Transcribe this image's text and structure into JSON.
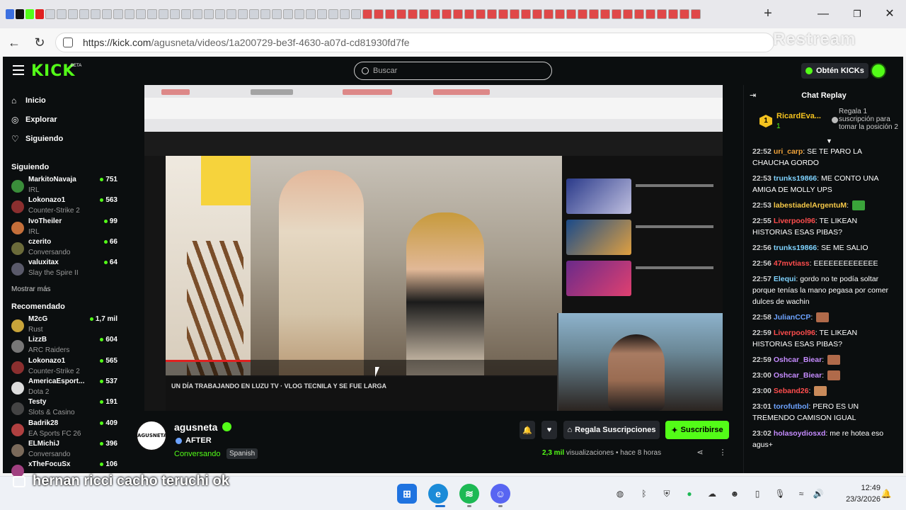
{
  "browser": {
    "url_host": "https://kick.com",
    "url_path": "/agusneta/videos/1a200729-be3f-4630-a07d-cd81930fd7fe",
    "watermark": "Restream"
  },
  "header": {
    "logo": "KICK",
    "logo_badge": "BETA",
    "search_placeholder": "Buscar",
    "kicks_button": "Obtén KICKs"
  },
  "sidebar": {
    "nav": [
      {
        "label": "Inicio",
        "icon": "home-icon"
      },
      {
        "label": "Explorar",
        "icon": "compass-icon"
      },
      {
        "label": "Siguiendo",
        "icon": "heart-icon"
      }
    ],
    "following_title": "Siguiendo",
    "following": [
      {
        "name": "MarkitoNavaja",
        "category": "IRL",
        "viewers": "751",
        "color": "#3a8d3a"
      },
      {
        "name": "Lokonazo1",
        "category": "Counter-Strike 2",
        "viewers": "563",
        "color": "#8b2f2f"
      },
      {
        "name": "IvoTheiler",
        "category": "IRL",
        "viewers": "99",
        "color": "#c46f3a"
      },
      {
        "name": "czerito",
        "category": "Conversando",
        "viewers": "66",
        "color": "#6b6b3a"
      },
      {
        "name": "valuxitax",
        "category": "Slay the Spire II",
        "viewers": "64",
        "color": "#5a5a6a"
      }
    ],
    "show_more": "Mostrar más",
    "recommended_title": "Recomendado",
    "recommended": [
      {
        "name": "M2cG",
        "category": "Rust",
        "viewers": "1,7 mil",
        "color": "#c8a43a"
      },
      {
        "name": "LizzB",
        "category": "ARC Raiders",
        "viewers": "604",
        "color": "#777"
      },
      {
        "name": "Lokonazo1",
        "category": "Counter-Strike 2",
        "viewers": "565",
        "color": "#8b2f2f"
      },
      {
        "name": "AmericaEsport...",
        "category": "Dota 2",
        "viewers": "537",
        "color": "#ddd"
      },
      {
        "name": "Testy",
        "category": "Slots & Casino",
        "viewers": "191",
        "color": "#444"
      },
      {
        "name": "Badrik28",
        "category": "EA Sports FC 26",
        "viewers": "409",
        "color": "#b04040"
      },
      {
        "name": "ELMichiJ",
        "category": "Conversando",
        "viewers": "396",
        "color": "#7a6a5a"
      },
      {
        "name": "xTheFocuSx",
        "category": "",
        "viewers": "106",
        "color": "#a04080"
      }
    ]
  },
  "video": {
    "caption": "UN DÍA TRABAJANDO EN LUZU TV · VLOG TECNILA Y SE FUE LARGA"
  },
  "stream": {
    "channel_logo_text": "AGUSNETA",
    "streamer": "agusneta",
    "title": "AFTER",
    "category": "Conversando",
    "tag": "Spanish",
    "gift_button": "Regala Suscripciones",
    "subscribe_button": "Suscribirse",
    "views_count": "2,3 mil",
    "views_label": "visualizaciones",
    "separator": "•",
    "time_ago": "hace 8 horas"
  },
  "chat": {
    "title": "Chat Replay",
    "pinned": {
      "rank": "1",
      "user": "RicardEva...",
      "count": "1",
      "message": "Regala 1 suscripción para tomar la posición 2"
    },
    "messages": [
      {
        "time": "22:52",
        "user": "uri_carp",
        "color": "#f0a33a",
        "text": "SE TE PARO LA CHAUCHA GORDO",
        "emote": ""
      },
      {
        "time": "22:53",
        "user": "trunks19866",
        "color": "#7fd3ff",
        "text": "ME CONTO UNA AMIGA DE MOLLY UPS",
        "emote": ""
      },
      {
        "time": "22:53",
        "user": "labestiadelArgentuM",
        "color": "#f7c948",
        "text": "",
        "emote": "#3aa33a"
      },
      {
        "time": "22:55",
        "user": "Liverpool96",
        "color": "#ff4d4d",
        "text": "TE LIKEAN HISTORIAS ESAS PIBAS?",
        "emote": ""
      },
      {
        "time": "22:56",
        "user": "trunks19866",
        "color": "#7fd3ff",
        "text": "SE ME SALIO",
        "emote": ""
      },
      {
        "time": "22:56",
        "user": "47mvtiass",
        "color": "#ff4d4d",
        "text": "EEEEEEEEEEEEE",
        "emote": ""
      },
      {
        "time": "22:57",
        "user": "Elequi",
        "color": "#7fd3ff",
        "text": "gordo no te podía soltar porque tenías la mano pegasa por comer dulces de wachin",
        "emote": ""
      },
      {
        "time": "22:58",
        "user": "JulianCCP",
        "color": "#6da3ff",
        "text": "",
        "emote": "#b06a4a"
      },
      {
        "time": "22:59",
        "user": "Liverpool96",
        "color": "#ff4d4d",
        "text": "TE LIKEAN HISTORIAS ESAS PIBAS?",
        "emote": ""
      },
      {
        "time": "22:59",
        "user": "Oshcar_Biear",
        "color": "#c58bff",
        "text": "",
        "emote": "#b06a4a"
      },
      {
        "time": "23:00",
        "user": "Oshcar_Biear",
        "color": "#c58bff",
        "text": "",
        "emote": "#b06a4a"
      },
      {
        "time": "23:00",
        "user": "Seband26",
        "color": "#ff4d4d",
        "text": "",
        "emote": "#c98a5a"
      },
      {
        "time": "23:01",
        "user": "torofutbol",
        "color": "#6da3ff",
        "text": "PERO ES UN TREMENDO CAMISON IGUAL",
        "emote": ""
      },
      {
        "time": "23:02",
        "user": "holasoydiosxd",
        "color": "#c58bff",
        "text": "me re hotea eso agus+",
        "emote": ""
      }
    ]
  },
  "overlay_caption": "hernan ricci cacho teruchi ok",
  "taskbar": {
    "time": "12:49",
    "date": "23/3/2026"
  },
  "colors": {
    "kick_green": "#53fc18",
    "app_bg": "#0b0e0f"
  }
}
